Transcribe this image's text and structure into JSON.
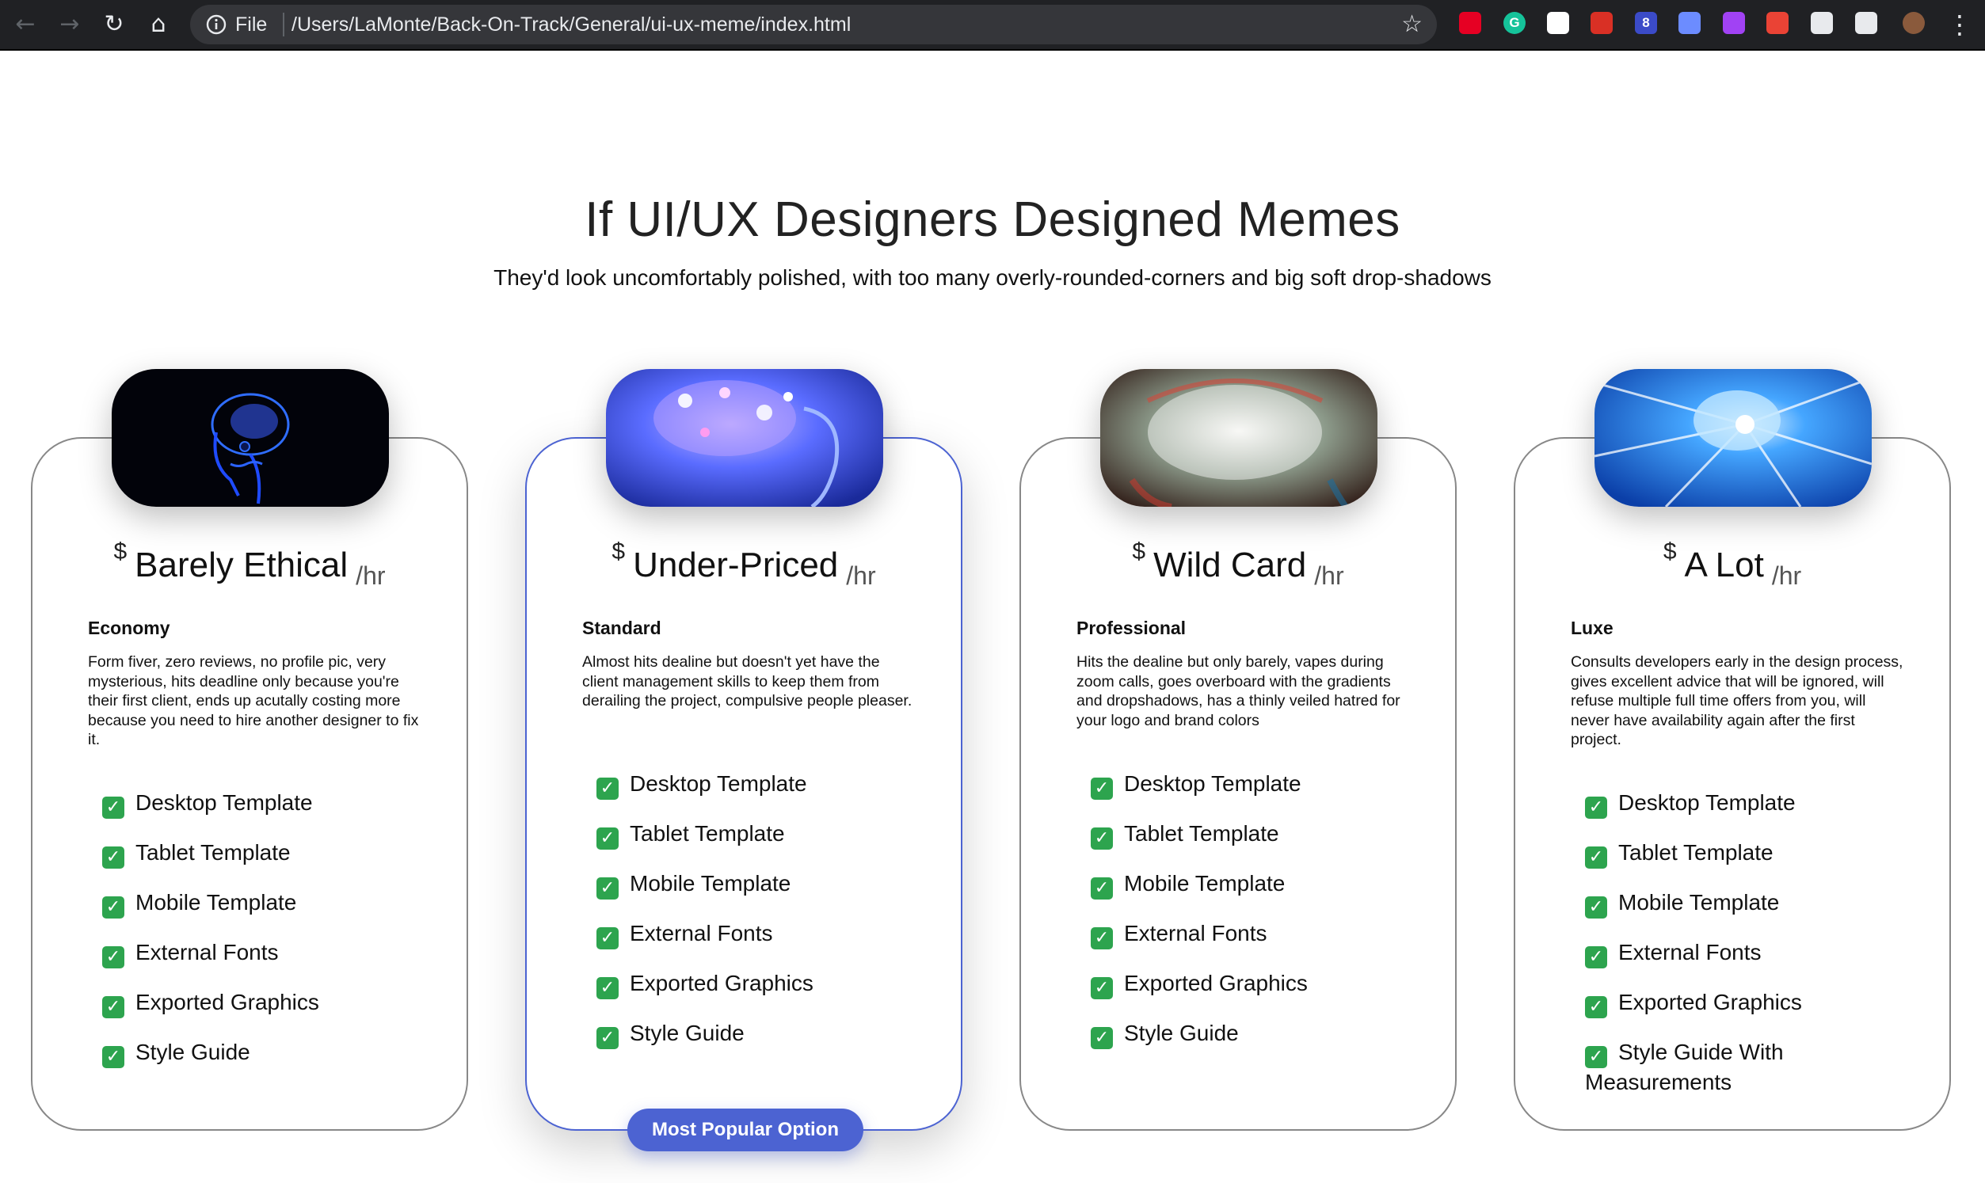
{
  "browser": {
    "back": "←",
    "forward": "→",
    "reload": "↻",
    "home": "⌂",
    "scheme_label": "File",
    "url": "/Users/LaMonte/Back-On-Track/General/ui-ux-meme/index.html",
    "bookmark": "☆",
    "menu": "⋮",
    "extensions": [
      {
        "name": "pinterest-save-extension-icon",
        "color": "#e60023",
        "text": ""
      },
      {
        "name": "grammarly-extension-icon",
        "color": "#15c39a",
        "text": "G"
      },
      {
        "name": "panda-extension-icon",
        "color": "#ffffff",
        "text": ""
      },
      {
        "name": "calendar-extension-icon",
        "color": "#d93025",
        "text": ""
      },
      {
        "name": "badge-extension-icon",
        "color": "#3b4bc8",
        "text": "8"
      },
      {
        "name": "wave-extension-icon",
        "color": "#6c8cff",
        "text": ""
      },
      {
        "name": "color-picker-extension-icon",
        "color": "#a142f4",
        "text": ""
      },
      {
        "name": "pen-extension-icon",
        "color": "#ea4335",
        "text": ""
      },
      {
        "name": "puzzle-extensions-icon",
        "color": "#e8eaed",
        "text": ""
      },
      {
        "name": "cast-icon",
        "color": "#e8eaed",
        "text": ""
      }
    ]
  },
  "hero": {
    "title": "If UI/UX Designers Designed Memes",
    "subtitle": "They'd look uncomfortably polished, with too many overly-rounded-corners and big soft drop-shadows"
  },
  "plans": [
    {
      "currency": "$",
      "name": "Barely Ethical",
      "per": "/hr",
      "tier": "Economy",
      "description": "Form fiver, zero reviews, no profile pic, very mysterious, hits deadline only because you're their first client, ends up acutally costing more because you need to hire another designer to fix it.",
      "features": [
        "Desktop Template",
        "Tablet Template",
        "Mobile Template",
        "External Fonts",
        "Exported Graphics",
        "Style Guide"
      ]
    },
    {
      "currency": "$",
      "name": "Under-Priced",
      "per": "/hr",
      "tier": "Standard",
      "description": "Almost hits dealine but doesn't yet have the client management skills to keep them from derailing the project, compulsive people pleaser.",
      "features": [
        "Desktop Template",
        "Tablet Template",
        "Mobile Template",
        "External Fonts",
        "Exported Graphics",
        "Style Guide"
      ],
      "badge": "Most Popular Option"
    },
    {
      "currency": "$",
      "name": "Wild Card",
      "per": "/hr",
      "tier": "Professional",
      "description": "Hits the dealine but only barely, vapes during zoom calls, goes overboard with the gradients and dropshadows, has a thinly veiled hatred for your logo and brand colors",
      "features": [
        "Desktop Template",
        "Tablet Template",
        "Mobile Template",
        "External Fonts",
        "Exported Graphics",
        "Style Guide"
      ]
    },
    {
      "currency": "$",
      "name": "A Lot",
      "per": "/hr",
      "tier": "Luxe",
      "description": "Consults developers early in the design process, gives excellent advice that will be ignored, will refuse multiple full time offers from you, will never have availability again after the first project.",
      "features": [
        "Desktop Template",
        "Tablet Template",
        "Mobile Template",
        "External Fonts",
        "Exported Graphics",
        "Style Guide With Measurements"
      ]
    }
  ],
  "colors": {
    "accent": "#4c63d2",
    "check": "#2da44e",
    "toolbar": "#202124"
  }
}
